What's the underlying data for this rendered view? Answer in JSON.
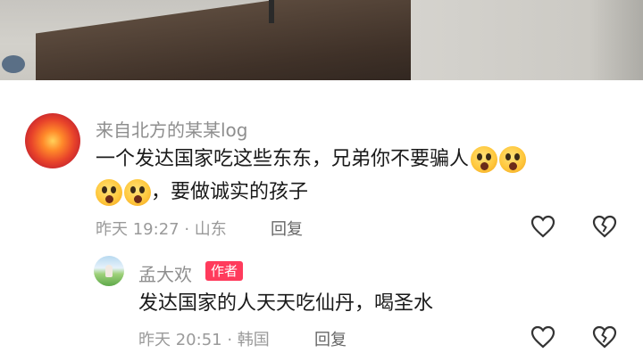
{
  "comments": [
    {
      "username": "来自北方的某某log",
      "text_line1": "一个发达国家吃这些东东，兄弟你不要骗人",
      "text_line2": "，要做诚实的孩子",
      "emoji_icon": "astonished-face-icon",
      "time": "昨天 19:27",
      "location": "山东",
      "reply_label": "回复"
    },
    {
      "username": "孟大欢",
      "badge": "作者",
      "text": "发达国家的人天天吃仙丹，喝圣水",
      "time": "昨天 20:51",
      "location": "韩国",
      "reply_label": "回复"
    }
  ],
  "colors": {
    "author_badge": "#ff3b5c",
    "meta_text": "#9a9a9a",
    "name_text": "#8e8e8e"
  }
}
